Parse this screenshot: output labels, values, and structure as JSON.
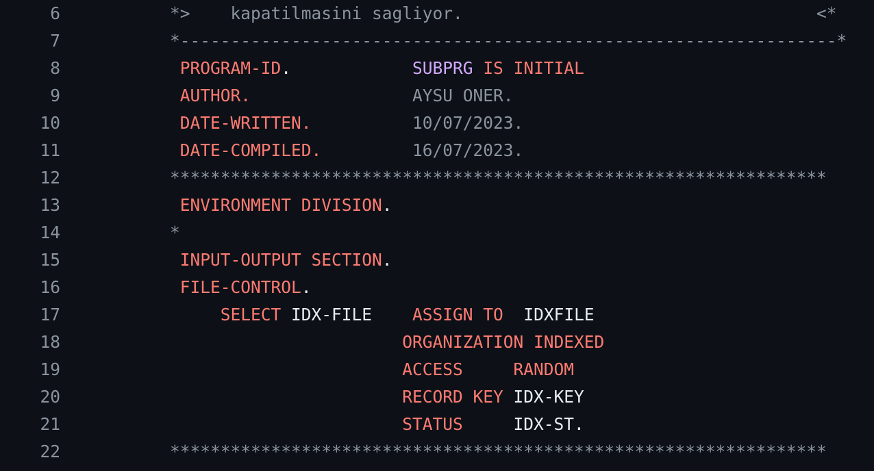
{
  "colors": {
    "background": "#0d1117",
    "line_number": "#8b949e",
    "keyword": "#ff7b72",
    "function": "#d2a8ff",
    "comment": "#8b949e",
    "default": "#e6edf3"
  },
  "lines": [
    {
      "number": "6",
      "tokens": [
        {
          "t": "*>    kapatilmasini sagliyor.                                   <*",
          "c": "cm"
        }
      ]
    },
    {
      "number": "7",
      "tokens": [
        {
          "t": "*-----------------------------------------------------------------*",
          "c": "cm"
        }
      ]
    },
    {
      "number": "8",
      "tokens": [
        {
          "t": " ",
          "c": "id"
        },
        {
          "t": "PROGRAM-ID",
          "c": "kw"
        },
        {
          "t": ".            ",
          "c": "id"
        },
        {
          "t": "SUBPRG",
          "c": "fn"
        },
        {
          "t": " ",
          "c": "id"
        },
        {
          "t": "IS INITIAL",
          "c": "kw"
        }
      ]
    },
    {
      "number": "9",
      "tokens": [
        {
          "t": " ",
          "c": "id"
        },
        {
          "t": "AUTHOR.",
          "c": "kw"
        },
        {
          "t": "                ",
          "c": "id"
        },
        {
          "t": "AYSU ONER.",
          "c": "cm"
        }
      ]
    },
    {
      "number": "10",
      "tokens": [
        {
          "t": " ",
          "c": "id"
        },
        {
          "t": "DATE-WRITTEN.",
          "c": "kw"
        },
        {
          "t": "          ",
          "c": "id"
        },
        {
          "t": "10/07/2023.",
          "c": "cm"
        }
      ]
    },
    {
      "number": "11",
      "tokens": [
        {
          "t": " ",
          "c": "id"
        },
        {
          "t": "DATE-COMPILED.",
          "c": "kw"
        },
        {
          "t": "         ",
          "c": "id"
        },
        {
          "t": "16/07/2023.",
          "c": "cm"
        }
      ]
    },
    {
      "number": "12",
      "tokens": [
        {
          "t": "*****************************************************************",
          "c": "cm"
        }
      ]
    },
    {
      "number": "13",
      "tokens": [
        {
          "t": " ",
          "c": "id"
        },
        {
          "t": "ENVIRONMENT DIVISION",
          "c": "kw"
        },
        {
          "t": ".",
          "c": "id"
        }
      ]
    },
    {
      "number": "14",
      "tokens": [
        {
          "t": "*",
          "c": "cm"
        }
      ]
    },
    {
      "number": "15",
      "tokens": [
        {
          "t": " ",
          "c": "id"
        },
        {
          "t": "INPUT-OUTPUT SECTION",
          "c": "kw"
        },
        {
          "t": ".",
          "c": "id"
        }
      ]
    },
    {
      "number": "16",
      "tokens": [
        {
          "t": " ",
          "c": "id"
        },
        {
          "t": "FILE-CONTROL",
          "c": "kw"
        },
        {
          "t": ".",
          "c": "id"
        }
      ]
    },
    {
      "number": "17",
      "tokens": [
        {
          "t": "     ",
          "c": "id"
        },
        {
          "t": "SELECT",
          "c": "kw"
        },
        {
          "t": " IDX-FILE    ",
          "c": "id"
        },
        {
          "t": "ASSIGN TO",
          "c": "kw"
        },
        {
          "t": "  IDXFILE",
          "c": "id"
        }
      ]
    },
    {
      "number": "18",
      "tokens": [
        {
          "t": "                       ",
          "c": "id"
        },
        {
          "t": "ORGANIZATION INDEXED",
          "c": "kw"
        }
      ]
    },
    {
      "number": "19",
      "tokens": [
        {
          "t": "                       ",
          "c": "id"
        },
        {
          "t": "ACCESS     RANDOM",
          "c": "kw"
        }
      ]
    },
    {
      "number": "20",
      "tokens": [
        {
          "t": "                       ",
          "c": "id"
        },
        {
          "t": "RECORD KEY",
          "c": "kw"
        },
        {
          "t": " IDX-KEY",
          "c": "id"
        }
      ]
    },
    {
      "number": "21",
      "tokens": [
        {
          "t": "                       ",
          "c": "id"
        },
        {
          "t": "STATUS",
          "c": "kw"
        },
        {
          "t": "     IDX-ST.",
          "c": "id"
        }
      ]
    },
    {
      "number": "22",
      "tokens": [
        {
          "t": "*****************************************************************",
          "c": "cm"
        }
      ]
    }
  ]
}
